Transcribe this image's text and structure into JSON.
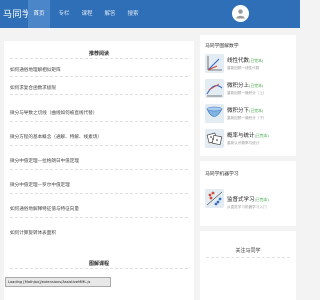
{
  "header": {
    "logo": "马同学",
    "nav": [
      "首页",
      "专栏",
      "课程",
      "解答",
      "搜索"
    ],
    "colors": {
      "bar": "#2f6fb7",
      "active": "#4a86c8"
    },
    "avatar_icon": "user-icon"
  },
  "recommend": {
    "title": "推荐阅读",
    "items": [
      "如何通俗地理解相似矩阵",
      "如何求复合函数求极限",
      "微分与导数之切线（曲线如何被直线代替）",
      "微分方程的基本概念（通解、特解、线素场）",
      "微分中值定理—拉格朗日中值定理",
      "微分中值定理—罗尔中值定理",
      "如何通俗地解释特征值与特征向量",
      "如何计算旋转体表面积"
    ]
  },
  "courses_section": {
    "title": "图解课程",
    "loading_text": "Loading [MathJax]/extensions/AssistiveMML.js"
  },
  "sidebar": {
    "math_title": "马同学图解数学",
    "courses": [
      {
        "name": "线性代数",
        "tag": "(已完本)",
        "desc": "重新回顾一线性代数",
        "icon": "linear-algebra-icon"
      },
      {
        "name": "微积分上",
        "tag": "(已完本)",
        "desc": "重新回顾一微积分（上）",
        "icon": "calculus-1-icon"
      },
      {
        "name": "微积分下",
        "tag": "(已完本)",
        "desc": "重新回顾一微积分（下）",
        "icon": "calculus-2-icon"
      },
      {
        "name": "概率与统计",
        "tag": "(已完本)",
        "desc": "重新认识概率与统计",
        "icon": "probability-icon"
      }
    ],
    "ml_title": "马同学机器学习",
    "ml_courses": [
      {
        "name": "监督式学习",
        "tag": "(已完本)",
        "desc": "从直觉学习机器学习入门",
        "icon": "supervised-learning-icon"
      }
    ],
    "follow_title": "关注马同学"
  }
}
